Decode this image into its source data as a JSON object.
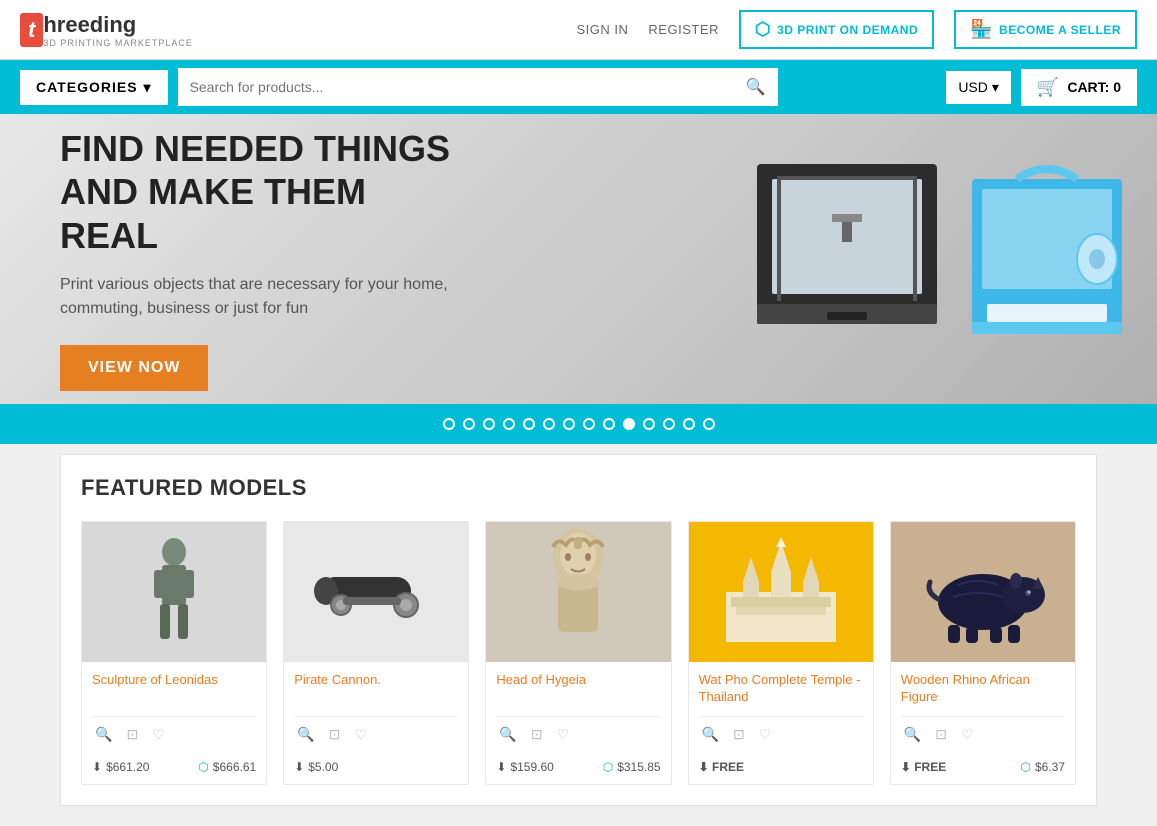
{
  "site": {
    "logo_letter": "t",
    "logo_name": "hreeding",
    "logo_subtitle": "3D PRINTING MARKETPLACE"
  },
  "header": {
    "sign_in": "SIGN IN",
    "register": "REGISTER",
    "btn_3d_print": "3D PRINT ON DEMAND",
    "btn_seller": "BECOME A SELLER"
  },
  "navbar": {
    "categories_label": "CATEGORIES",
    "search_placeholder": "Search for products...",
    "currency": "USD",
    "cart_label": "CART: 0"
  },
  "hero": {
    "title": "FIND NEEDED THINGS AND MAKE THEM REAL",
    "subtitle": "Print various objects that are necessary for your home, commuting, business or just for fun",
    "cta": "VIEW NOW"
  },
  "slider": {
    "dots": 14,
    "active_dot": 10
  },
  "featured": {
    "title": "FEATURED MODELS",
    "products": [
      {
        "name": "Sculpture of Leonidas",
        "price_download": "$661.20",
        "price_print": "$666.61",
        "image_class": "img-leonidas",
        "image_emoji": "🗿"
      },
      {
        "name": "Pirate Cannon.",
        "price_download": "$5.00",
        "price_print": "",
        "image_class": "img-cannon",
        "image_emoji": "💣"
      },
      {
        "name": "Head of Hygeia",
        "price_download": "$159.60",
        "price_print": "$315.85",
        "image_class": "img-hygeia",
        "image_emoji": "🏛️"
      },
      {
        "name": "Wat Pho Complete Temple - Thailand",
        "price_download": "FREE",
        "price_print": "",
        "image_class": "img-watpho",
        "image_emoji": "🏯"
      },
      {
        "name": "Wooden Rhino African Figure",
        "price_download": "FREE",
        "price_print": "$6.37",
        "image_class": "img-rhino",
        "image_emoji": "🦏"
      }
    ]
  },
  "icons": {
    "search": "🔍",
    "cart": "🛒",
    "magnify": "🔍",
    "frame": "⊞",
    "heart": "♡",
    "download": "⬇",
    "printer": "🖨",
    "chevron": "▾",
    "printer_3d": "⬡",
    "store": "🏪"
  }
}
